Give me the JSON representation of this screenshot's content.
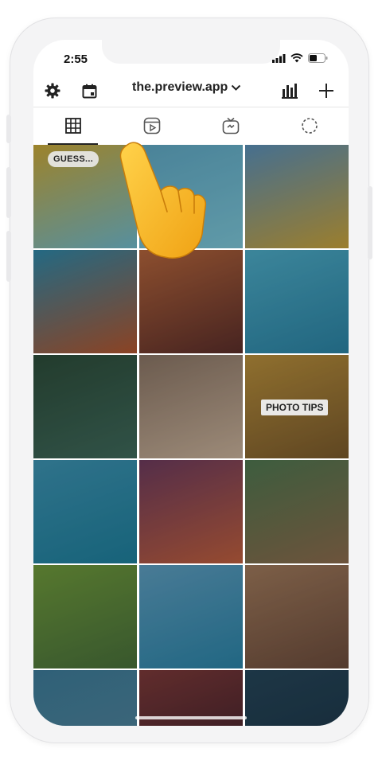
{
  "status_bar": {
    "time": "2:55"
  },
  "top_bar": {
    "account_name": "the.preview.app"
  },
  "tabs": [
    {
      "name": "grid",
      "active": true
    },
    {
      "name": "reels",
      "active": false
    },
    {
      "name": "igtv",
      "active": false
    },
    {
      "name": "stories",
      "active": false
    }
  ],
  "grid": {
    "cells": [
      {
        "label": "GUESS...",
        "colors": [
          "#c9a838",
          "#6fb9cc"
        ]
      },
      {
        "label": "",
        "colors": [
          "#5fa8c4",
          "#7cc6d8"
        ]
      },
      {
        "label": "",
        "colors": [
          "#5a8fb8",
          "#c8a23a"
        ]
      },
      {
        "label": "",
        "colors": [
          "#2e87a8",
          "#b3562e"
        ]
      },
      {
        "label": "",
        "colors": [
          "#b4653c",
          "#5b2e2a"
        ]
      },
      {
        "label": "",
        "colors": [
          "#4dabc6",
          "#2b83a4"
        ]
      },
      {
        "label": "",
        "colors": [
          "#2d4d3a",
          "#3f6a5c"
        ]
      },
      {
        "label": "",
        "colors": [
          "#8a7565",
          "#c9b29b"
        ]
      },
      {
        "label": "PHOTO TIPS",
        "colors": [
          "#b88f3c",
          "#7a5a2c"
        ]
      },
      {
        "label": "",
        "colors": [
          "#3d93b2",
          "#1e7f9c"
        ]
      },
      {
        "label": "",
        "colors": [
          "#6d3b5e",
          "#c0603e"
        ]
      },
      {
        "label": "",
        "colors": [
          "#4f7750",
          "#8c6b4d"
        ]
      },
      {
        "label": "",
        "colors": [
          "#6f9a3c",
          "#48703a"
        ]
      },
      {
        "label": "",
        "colors": [
          "#5e9ec0",
          "#2b84a8"
        ]
      },
      {
        "label": "",
        "colors": [
          "#a07a5c",
          "#6c4c3c"
        ]
      },
      {
        "label": "",
        "colors": [
          "#3d7c9a",
          "#54869c"
        ]
      },
      {
        "label": "",
        "colors": [
          "#7d3a3a",
          "#3c1f2a"
        ]
      },
      {
        "label": "",
        "colors": [
          "#26465a",
          "#1b3547"
        ]
      }
    ]
  },
  "colors": {
    "accent": "#222222",
    "hand": "#f5b72e"
  }
}
